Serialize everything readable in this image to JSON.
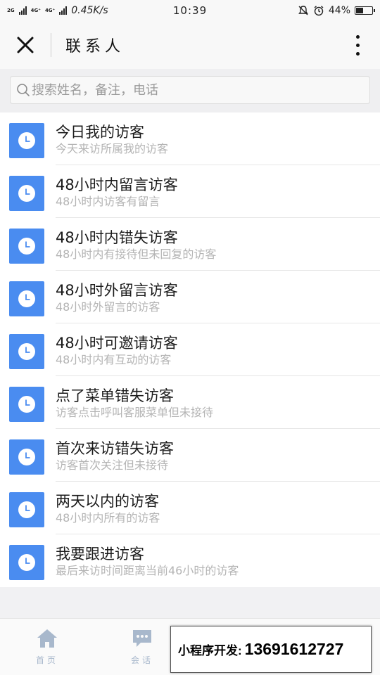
{
  "status_bar": {
    "net_labels": [
      "2G",
      "4G⁺",
      "4G⁺",
      "2G"
    ],
    "speed": "0.45K/s",
    "time": "10:39",
    "battery": "44%",
    "battery_level": 0.44
  },
  "header": {
    "title": "联系人",
    "close_icon": "close-icon",
    "more_icon": "more-vertical-icon"
  },
  "search": {
    "placeholder": "搜索姓名，备注，电话",
    "value": ""
  },
  "list": {
    "icon": "clock-icon",
    "icon_color": "#4a8cf0",
    "items": [
      {
        "title": "今日我的访客",
        "subtitle": "今天来访所属我的访客"
      },
      {
        "title": "48小时内留言访客",
        "subtitle": "48小时内访客有留言"
      },
      {
        "title": "48小时内错失访客",
        "subtitle": "48小时内有接待但未回复的访客"
      },
      {
        "title": "48小时外留言访客",
        "subtitle": "48小时外留言的访客"
      },
      {
        "title": "48小时可邀请访客",
        "subtitle": "48小时内有互动的访客"
      },
      {
        "title": "点了菜单错失访客",
        "subtitle": "访客点击呼叫客服菜单但未接待"
      },
      {
        "title": "首次来访错失访客",
        "subtitle": "访客首次关注但未接待"
      },
      {
        "title": "两天以内的访客",
        "subtitle": "48小时内所有的访客"
      },
      {
        "title": "我要跟进访客",
        "subtitle": "最后来访时间距离当前46小时的访客"
      }
    ]
  },
  "tabbar": {
    "home_label": "首页",
    "chat_label": "会话",
    "inactive_color": "#a8b8cc"
  },
  "ad": {
    "label": "小程序开发:",
    "phone": "13691612727"
  }
}
